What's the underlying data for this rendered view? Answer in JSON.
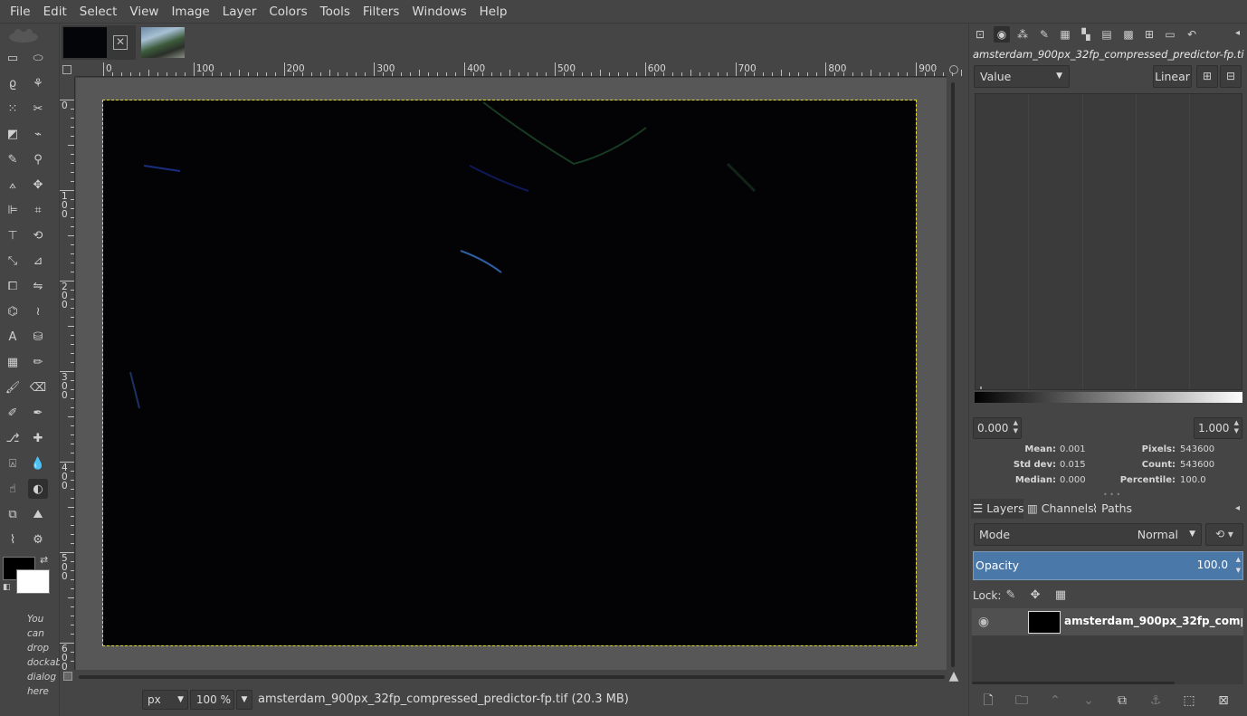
{
  "menubar": {
    "items": [
      "File",
      "Edit",
      "Select",
      "View",
      "Image",
      "Layer",
      "Colors",
      "Tools",
      "Filters",
      "Windows",
      "Help"
    ]
  },
  "toolbox": {
    "tools": [
      {
        "name": "rect-select-icon",
        "glyph": "▭"
      },
      {
        "name": "ellipse-select-icon",
        "glyph": "⬭"
      },
      {
        "name": "free-select-icon",
        "glyph": "ϱ"
      },
      {
        "name": "fuzzy-select-icon",
        "glyph": "⚘"
      },
      {
        "name": "select-by-color-icon",
        "glyph": "⁙"
      },
      {
        "name": "scissors-select-icon",
        "glyph": "✂"
      },
      {
        "name": "foreground-select-icon",
        "glyph": "◩"
      },
      {
        "name": "paths-tool-icon",
        "glyph": "⌁"
      },
      {
        "name": "color-picker-icon",
        "glyph": "✎"
      },
      {
        "name": "zoom-tool-icon",
        "glyph": "⚲"
      },
      {
        "name": "measure-tool-icon",
        "glyph": "⟑"
      },
      {
        "name": "move-tool-icon",
        "glyph": "✥"
      },
      {
        "name": "align-tool-icon",
        "glyph": "⊫"
      },
      {
        "name": "crop-tool-icon",
        "glyph": "⌗"
      },
      {
        "name": "unified-transform-icon",
        "glyph": "⊤"
      },
      {
        "name": "rotate-tool-icon",
        "glyph": "⟲"
      },
      {
        "name": "scale-tool-icon",
        "glyph": "⤡"
      },
      {
        "name": "shear-tool-icon",
        "glyph": "⊿"
      },
      {
        "name": "perspective-tool-icon",
        "glyph": "⧠"
      },
      {
        "name": "flip-tool-icon",
        "glyph": "⇋"
      },
      {
        "name": "cage-transform-icon",
        "glyph": "⌬"
      },
      {
        "name": "warp-transform-icon",
        "glyph": "≀"
      },
      {
        "name": "text-tool-icon",
        "glyph": "A"
      },
      {
        "name": "bucket-fill-icon",
        "glyph": "⛁"
      },
      {
        "name": "blend-tool-icon",
        "glyph": "▦"
      },
      {
        "name": "pencil-tool-icon",
        "glyph": "✏"
      },
      {
        "name": "paintbrush-tool-icon",
        "glyph": "🖌"
      },
      {
        "name": "eraser-tool-icon",
        "glyph": "⌫"
      },
      {
        "name": "airbrush-tool-icon",
        "glyph": "✐"
      },
      {
        "name": "ink-tool-icon",
        "glyph": "✒"
      },
      {
        "name": "clone-tool-icon",
        "glyph": "⎇"
      },
      {
        "name": "heal-tool-icon",
        "glyph": "✚"
      },
      {
        "name": "perspective-clone-icon",
        "glyph": "⍓"
      },
      {
        "name": "blur-sharpen-icon",
        "glyph": "💧"
      },
      {
        "name": "smudge-tool-icon",
        "glyph": "☝"
      },
      {
        "name": "dodge-burn-icon",
        "glyph": "◐"
      },
      {
        "name": "gegl-tool-icon",
        "glyph": "⧉"
      },
      {
        "name": "threshold-tool-icon",
        "glyph": "⛰"
      },
      {
        "name": "seamless-clone-icon",
        "glyph": "⌇"
      },
      {
        "name": "handle-transform-icon",
        "glyph": "⚙"
      }
    ],
    "dock_hint": [
      "You",
      "can",
      "drop",
      "dockab",
      "dialog",
      "here"
    ]
  },
  "image_tabs": {
    "close_glyph": "✕"
  },
  "ruler_top": {
    "labels": [
      "0",
      "100",
      "200",
      "300",
      "400",
      "500",
      "600",
      "700",
      "800",
      "900"
    ]
  },
  "ruler_left": {
    "labels": [
      [
        "0"
      ],
      [
        "1",
        "0",
        "0"
      ],
      [
        "2",
        "0",
        "0"
      ],
      [
        "3",
        "0",
        "0"
      ],
      [
        "4",
        "0",
        "0"
      ],
      [
        "5",
        "0",
        "0"
      ],
      [
        "6",
        "0",
        "0"
      ]
    ]
  },
  "statusbar": {
    "unit": "px",
    "zoom": "100 %",
    "file_info": "amsterdam_900px_32fp_compressed_predictor-fp.tif (20.3 MB)"
  },
  "histogram": {
    "title": "amsterdam_900px_32fp_compressed_predictor-fp.tif",
    "channel": "Value",
    "scale_button": "Linear",
    "range_low": "0.000",
    "range_high": "1.000",
    "stats": {
      "mean_label": "Mean:",
      "mean_value": "0.001",
      "stddev_label": "Std dev:",
      "stddev_value": "0.015",
      "median_label": "Median:",
      "median_value": "0.000",
      "pixels_label": "Pixels:",
      "pixels_value": "543600",
      "count_label": "Count:",
      "count_value": "543600",
      "percentile_label": "Percentile:",
      "percentile_value": "100.0"
    }
  },
  "layers": {
    "tabs": {
      "layers": "Layers",
      "channels": "Channels",
      "paths": "Paths"
    },
    "mode_label": "Mode",
    "mode_value": "Normal",
    "opacity_label": "Opacity",
    "opacity_value": "100.0",
    "opacity_fraction": 1.0,
    "lock_label": "Lock:",
    "layer_name": "amsterdam_900px_32fp_compressed_predictor-fp.tif"
  },
  "colors": {
    "accent": "#4a78a8",
    "foreground": "#000000",
    "background": "#ffffff",
    "selection_marching_ants": "#e5d33a"
  }
}
